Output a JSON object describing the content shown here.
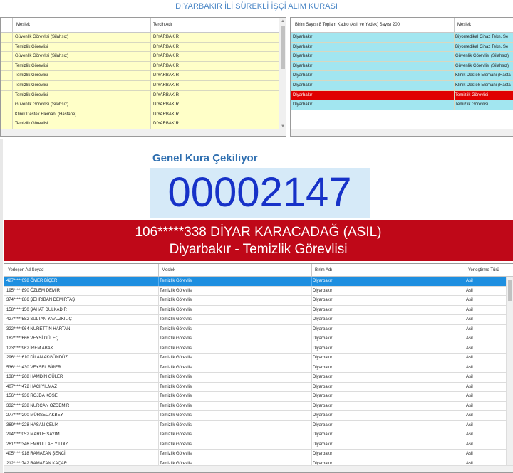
{
  "title": "DİYARBAKIR İLİ SÜREKLİ İŞÇİ ALIM KURASI",
  "left_table": {
    "headers": [
      "Meslek",
      "Tercih Adı"
    ],
    "rows": [
      [
        "Güvenlik Görevlisi (Silahsız)",
        "DIYARBAKIR"
      ],
      [
        "Temizlik Görevlisi",
        "DIYARBAKIR"
      ],
      [
        "Güvenlik Görevlisi (Silahsız)",
        "DIYARBAKIR"
      ],
      [
        "Temizlik Görevlisi",
        "DIYARBAKIR"
      ],
      [
        "Temizlik Görevlisi",
        "DIYARBAKIR"
      ],
      [
        "Temizlik Görevlisi",
        "DIYARBAKIR"
      ],
      [
        "Temizlik Görevlisi",
        "DIYARBAKIR"
      ],
      [
        "Güvenlik Görevlisi (Silahsız)",
        "DIYARBAKIR"
      ],
      [
        "Klinik Destek Elemanı (Hastane)",
        "DIYARBAKIR"
      ],
      [
        "Temizlik Görevlisi",
        "DIYARBAKIR"
      ]
    ]
  },
  "right_table": {
    "headers": [
      "Birim Sayısı 8 Toplam Kadro (Asil ve Yedek) Sayısı 200",
      "Meslek"
    ],
    "rows": [
      [
        "Diyarbakır",
        "Biyomedikal Cihaz Tekn. Se"
      ],
      [
        "Diyarbakır",
        "Biyomedikal Cihaz Tekn. Se"
      ],
      [
        "Diyarbakır",
        "Güvenlik Görevlisi (Silahsız)"
      ],
      [
        "Diyarbakır",
        "Güvenlik Görevlisi (Silahsız)"
      ],
      [
        "Diyarbakır",
        "Klinik Destek Elemanı (Hasta"
      ],
      [
        "Diyarbakır",
        "Klinik Destek Elemanı (Hasta"
      ],
      [
        "Diyarbakır",
        "Temizlik Görevlisi"
      ],
      [
        "Diyarbakır",
        "Temizlik Görevlisi"
      ]
    ],
    "highlight_index": 6
  },
  "draw": {
    "label": "Genel Kura Çekiliyor",
    "number": "00002147",
    "winner_line1": "106*****338 DİYAR KARACADAĞ (ASIL)",
    "winner_line2": "Diyarbakır - Temizlik Görevlisi"
  },
  "bottom_table": {
    "headers": [
      "Yerleşen Ad Soyad",
      "Meslek",
      "Birim Adı",
      "Yerleştirme Türü"
    ],
    "rows": [
      [
        "427*****098 ÖMER BİÇER",
        "Temizlik Görevlisi",
        "Diyarbakır",
        "Asil"
      ],
      [
        "195*****890 ÖZLEM DEMİR",
        "Temizlik Görevlisi",
        "Diyarbakır",
        "Asil"
      ],
      [
        "374*****886 ŞEHRİBAN DEMİRTAŞ",
        "Temizlik Görevlisi",
        "Diyarbakır",
        "Asil"
      ],
      [
        "158*****150 ŞAHAT DULKADİR",
        "Temizlik Görevlisi",
        "Diyarbakır",
        "Asil"
      ],
      [
        "427*****582 SULTAN YAVUZKILIÇ",
        "Temizlik Görevlisi",
        "Diyarbakır",
        "Asil"
      ],
      [
        "322*****964 NURETTİN HARTAN",
        "Temizlik Görevlisi",
        "Diyarbakır",
        "Asil"
      ],
      [
        "182*****666 VEYSİ GÜLEÇ",
        "Temizlik Görevlisi",
        "Diyarbakır",
        "Asil"
      ],
      [
        "123*****962 İREM ABAK",
        "Temizlik Görevlisi",
        "Diyarbakır",
        "Asil"
      ],
      [
        "296*****610 DİLAN AKGÜNDÜZ",
        "Temizlik Görevlisi",
        "Diyarbakır",
        "Asil"
      ],
      [
        "536*****430 VEYSEL BİRER",
        "Temizlik Görevlisi",
        "Diyarbakır",
        "Asil"
      ],
      [
        "138*****268 HAMDİN GÜLER",
        "Temizlik Görevlisi",
        "Diyarbakır",
        "Asil"
      ],
      [
        "407*****472 HACI YILMAZ",
        "Temizlik Görevlisi",
        "Diyarbakır",
        "Asil"
      ],
      [
        "156*****936 ROJDA KÖSE",
        "Temizlik Görevlisi",
        "Diyarbakır",
        "Asil"
      ],
      [
        "332*****238 NURCAN ÖZDEMİR",
        "Temizlik Görevlisi",
        "Diyarbakır",
        "Asil"
      ],
      [
        "277*****200 MÜRSEL AKBEY",
        "Temizlik Görevlisi",
        "Diyarbakır",
        "Asil"
      ],
      [
        "369*****228 HASAN ÇELİK",
        "Temizlik Görevlisi",
        "Diyarbakır",
        "Asil"
      ],
      [
        "294*****052 MARUF SAYIM",
        "Temizlik Görevlisi",
        "Diyarbakır",
        "Asil"
      ],
      [
        "261*****346 EMRULLAH YILDIZ",
        "Temizlik Görevlisi",
        "Diyarbakır",
        "Asil"
      ],
      [
        "405*****918 RAMAZAN ŞENCİ",
        "Temizlik Görevlisi",
        "Diyarbakır",
        "Asil"
      ],
      [
        "212*****742 RAMAZAN KAÇAR",
        "Temizlik Görevlisi",
        "Diyarbakır",
        "Asil"
      ]
    ],
    "selected_index": 0
  },
  "colors": {
    "title": "#4a86c6",
    "yellow_row": "#ffffc8",
    "cyan_row": "#a2e6f0",
    "highlight_red": "#e00000",
    "banner_red": "#bf0818",
    "counter_blue": "#1732c8",
    "counter_bg": "#d6eaf8",
    "selected_blue": "#1e8fe0"
  },
  "icons": {
    "scroll_up": "▲",
    "scroll_down": "▼"
  }
}
